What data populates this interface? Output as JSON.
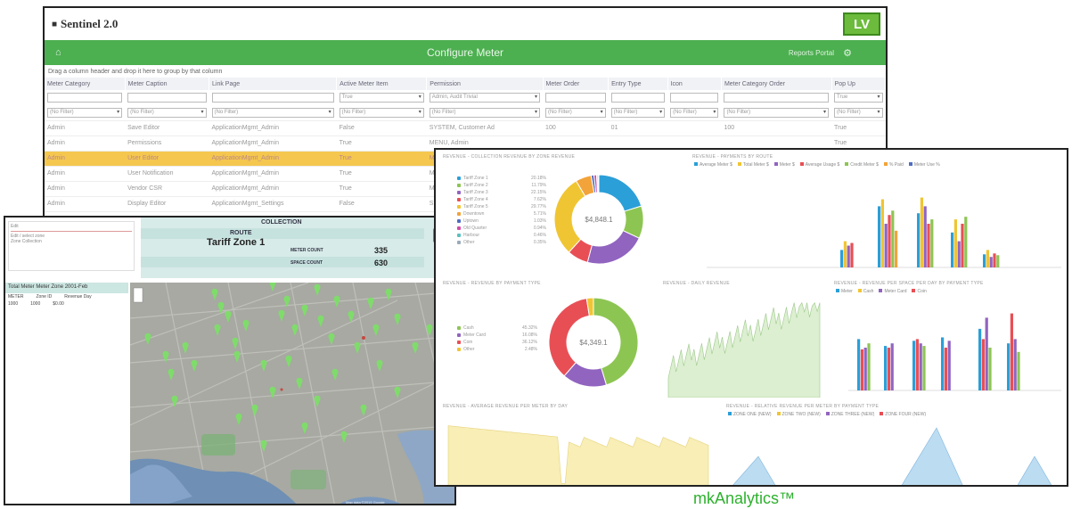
{
  "sentinel": {
    "title": "Sentinel 2.0",
    "logo_text": "LV",
    "nav_title": "Configure Meter",
    "user_label": "Reports Portal",
    "group_hint": "Drag a column header and drop it here to group by that column",
    "columns": [
      "Meter Category",
      "Meter Caption",
      "Link Page",
      "Active Meter Item",
      "Permission",
      "Meter Order",
      "Entry Type",
      "Icon",
      "Meter Category Order",
      "Pop Up"
    ],
    "filter_values": [
      "",
      "",
      "",
      "True",
      "Admin, Audit Trivial",
      "",
      "",
      "",
      "",
      "True"
    ],
    "filter_selects": [
      "(No Filter)",
      "(No Filter)",
      "(No Filter)",
      "(No Filter)",
      "(No Filter)",
      "(No Filter)",
      "(No Filter)",
      "(No Filter)",
      "(No Filter)",
      "(No Filter)"
    ],
    "rows": [
      [
        "Admin",
        "Save Editor",
        "ApplicationMgmt_Admin",
        "False",
        "SYSTEM, Customer Ad",
        "100",
        "01",
        "",
        "100",
        "True"
      ],
      [
        "Admin",
        "Permissions",
        "ApplicationMgmt_Admin",
        "True",
        "MENU, Admin",
        "",
        "",
        "",
        "",
        "True"
      ],
      [
        "Admin",
        "User Editor",
        "ApplicationMgmt_Admin",
        "True",
        "MENU, Admin",
        "",
        "",
        "",
        "",
        "True"
      ],
      [
        "Admin",
        "User Notification",
        "ApplicationMgmt_Admin",
        "True",
        "MENU, Admin",
        "",
        "",
        "",
        "",
        "True"
      ],
      [
        "Admin",
        "Vendor CSR",
        "ApplicationMgmt_Admin",
        "True",
        "MENU, Admin",
        "",
        "",
        "",
        "",
        "True"
      ],
      [
        "Admin",
        "Display Editor",
        "ApplicationMgmt_Settings",
        "False",
        "SYSTEM, Tools",
        "",
        "",
        "",
        "",
        "True"
      ]
    ],
    "selected_row": 2
  },
  "collection": {
    "header": "COLLECTION",
    "route_label": "ROUTE",
    "zone": "Tariff Zone 1",
    "meter_label": "METER COUNT",
    "meter_value": "335",
    "space_label": "SPACE COUNT",
    "space_value": "630",
    "side_title": "Total Meter Meter Zone 2001-Feb",
    "side_cols": [
      "METER",
      "Zone ID",
      "Revenue Day"
    ],
    "side_row": [
      "1000",
      "1000",
      "$0.00"
    ],
    "input_lines": [
      "Edit",
      "Edit / select zone",
      "Zone Collection"
    ],
    "map_credit": "Map data ©2015 Google"
  },
  "analytics": {
    "panel_titles": {
      "donut1": "REVENUE - COLLECTION REVENUE BY ZONE REVENUE",
      "bars1": "REVENUE - PAYMENTS BY ROUTE",
      "donut2": "REVENUE - REVENUE BY PAYMENT TYPE",
      "area1": "REVENUE - DAILY REVENUE",
      "bars2": "REVENUE - REVENUE PER SPACE PER DAY BY PAYMENT TYPE",
      "area2": "REVENUE - AVERAGE REVENUE PER METER BY DAY",
      "area3": "REVENUE - RELATIVE REVENUE PER METER BY PAYMENT TYPE"
    },
    "donut1_center": "$4,848.1",
    "donut1_legend": [
      {
        "label": "Tariff Zone 1",
        "value": "20.18%",
        "color": "#2b9fd8"
      },
      {
        "label": "Tariff Zone 2",
        "value": "11.79%",
        "color": "#8dc553"
      },
      {
        "label": "Tariff Zone 3",
        "value": "22.15%",
        "color": "#9164c0"
      },
      {
        "label": "Tariff Zone 4",
        "value": "7.62%",
        "color": "#e84f55"
      },
      {
        "label": "Tariff Zone 5",
        "value": "29.77%",
        "color": "#f0c533"
      },
      {
        "label": "Downtown",
        "value": "5.71%",
        "color": "#f2a33a"
      },
      {
        "label": "Uptown",
        "value": "1.03%",
        "color": "#4e6ec2"
      },
      {
        "label": "Old Quarter",
        "value": "0.94%",
        "color": "#d24ba8"
      },
      {
        "label": "Harbour",
        "value": "0.46%",
        "color": "#5cc0c0"
      },
      {
        "label": "Other",
        "value": "0.35%",
        "color": "#9ab"
      }
    ],
    "donut2_center": "$4,349.1",
    "donut2_legend": [
      {
        "label": "Cash",
        "value": "45.32%",
        "color": "#8dc553"
      },
      {
        "label": "Meter Card",
        "value": "16.08%",
        "color": "#9164c0"
      },
      {
        "label": "Coin",
        "value": "36.12%",
        "color": "#e84f55"
      },
      {
        "label": "Other",
        "value": "2.48%",
        "color": "#f0c533"
      }
    ],
    "bars1_legend": [
      "Average Meter $",
      "Total Meter $",
      "Meter $",
      "Average Usage $",
      "Credit Meter $",
      "% Paid",
      "Meter Use %"
    ],
    "bars2_legend": [
      "Meter",
      "Cash",
      "Meter Card",
      "Coin"
    ],
    "area3_legend": [
      "ZONE ONE (NEW)",
      "ZONE TWO (NEW)",
      "ZONE THREE (NEW)",
      "ZONE FOUR (NEW)"
    ]
  },
  "colors": {
    "green": "#4caf50",
    "select": "#f5c74f",
    "brand": "#2db12d"
  },
  "footer": "mkAnalytics™"
}
